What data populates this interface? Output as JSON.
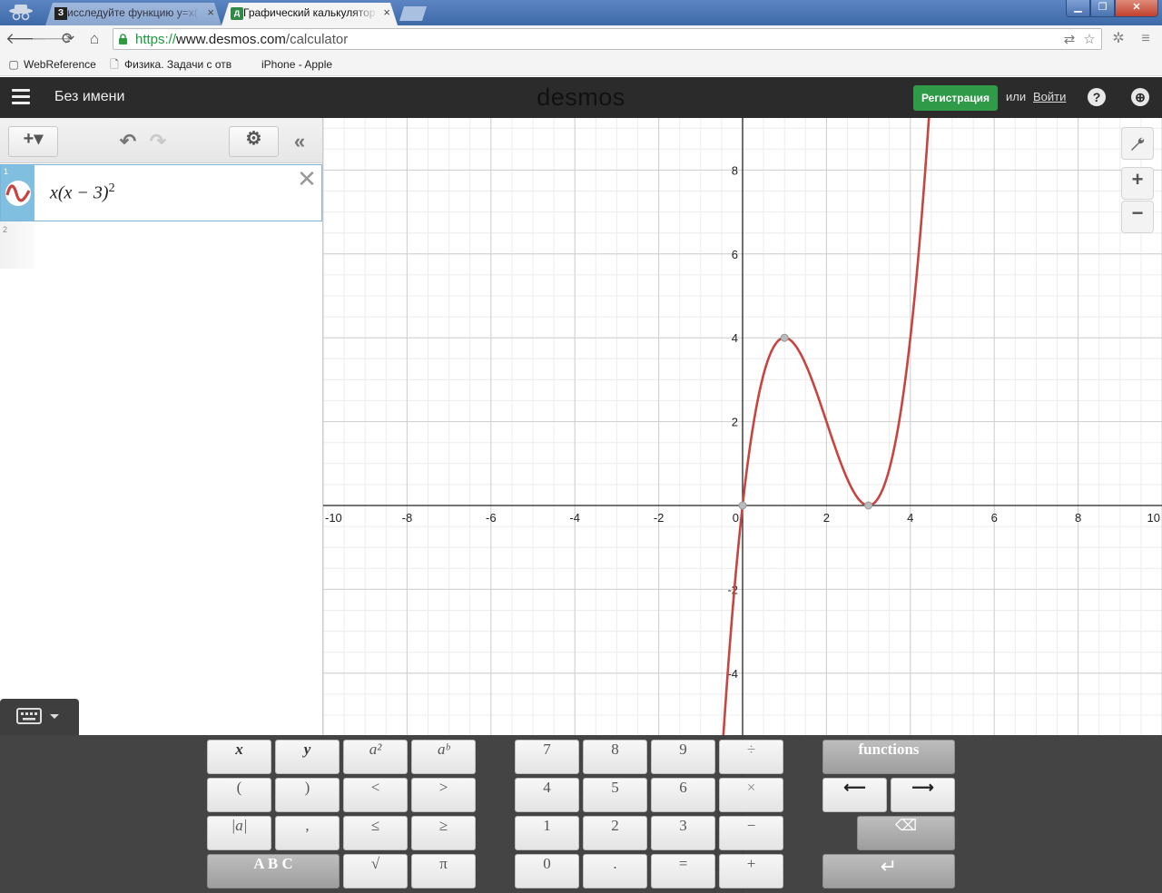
{
  "browser": {
    "tabs": [
      {
        "icon": "З",
        "title": "исследуйте функцию y=x(",
        "close": "×"
      },
      {
        "icon": "д",
        "title": "Графический калькулятор",
        "close": "×"
      }
    ],
    "window_buttons": {
      "minimize": "▁",
      "maximize": "❐",
      "close": "✕"
    },
    "url": {
      "scheme": "https://",
      "host": "www.desmos.com",
      "path": "/calculator"
    },
    "bookmarks": [
      {
        "label": "WebReference",
        "icon": "page-icon"
      },
      {
        "label": "Физика. Задачи с отв",
        "icon": "document-icon"
      },
      {
        "label": "iPhone - Apple",
        "icon": "apple-icon"
      }
    ]
  },
  "header": {
    "title": "Без имени",
    "logo": "desmos",
    "signup_label": "Регистрация",
    "or_label": "или",
    "login_label": "Войти",
    "help_label": "?",
    "globe_label": "⊕"
  },
  "expressions": {
    "toolbar": {
      "add_label": "+▾",
      "undo_label": "↶",
      "redo_label": "↷",
      "settings_label": "⚙",
      "collapse_label": "«"
    },
    "items": [
      {
        "index": "1",
        "latex_base": "x(x − 3)",
        "latex_exp": "2",
        "color": "#c74440",
        "delete_label": "✕"
      },
      {
        "index": "2"
      }
    ]
  },
  "graph": {
    "controls": {
      "wrench_label": "🔧",
      "zoom_in_label": "+",
      "zoom_out_label": "−"
    },
    "x_ticks": [
      "-10",
      "-8",
      "-6",
      "-4",
      "-2",
      "0",
      "2",
      "4",
      "6",
      "8",
      "10"
    ],
    "y_ticks": [
      "8",
      "6",
      "4",
      "2",
      "-2",
      "-4"
    ]
  },
  "chart_data": {
    "type": "line",
    "title": "",
    "xlabel": "",
    "ylabel": "",
    "xlim": [
      -10,
      10
    ],
    "ylim": [
      -9.2,
      9.2
    ],
    "grid": true,
    "series": [
      {
        "name": "",
        "expression": "x(x-3)^2",
        "color": "#c74440"
      }
    ],
    "points": [
      {
        "x": 0,
        "y": 0
      },
      {
        "x": 1,
        "y": 4
      },
      {
        "x": 3,
        "y": 0
      }
    ]
  },
  "keypad": {
    "toggle_label": "⌨ ▾",
    "left": [
      [
        "x",
        "y",
        "a²",
        "aᵇ"
      ],
      [
        "(",
        ")",
        "<",
        ">"
      ],
      [
        "|a|",
        ",",
        "≤",
        "≥"
      ],
      [
        "A B C",
        "√",
        "π"
      ]
    ],
    "middle": [
      [
        "7",
        "8",
        "9",
        "÷"
      ],
      [
        "4",
        "5",
        "6",
        "×"
      ],
      [
        "1",
        "2",
        "3",
        "−"
      ],
      [
        "0",
        ".",
        "=",
        "+"
      ]
    ],
    "right": {
      "functions_label": "functions",
      "left_arrow": "⟵",
      "right_arrow": "⟶",
      "backspace": "⌫",
      "enter": "↵"
    }
  }
}
